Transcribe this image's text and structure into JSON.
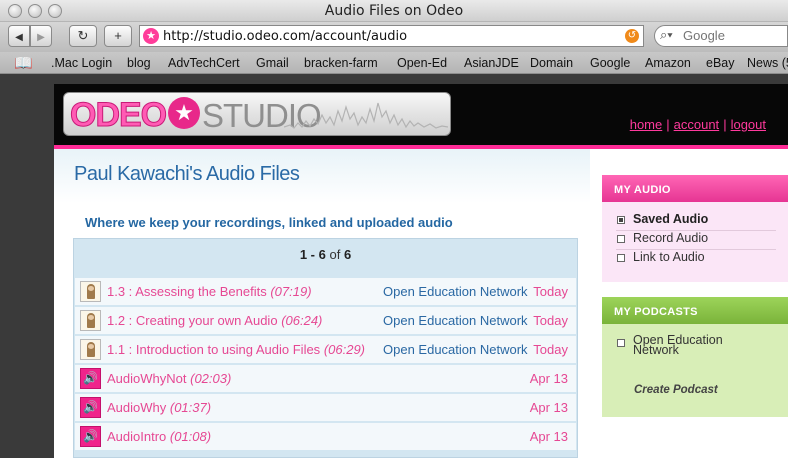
{
  "window": {
    "title": "Audio Files on Odeo"
  },
  "toolbar": {
    "back_label": "◀",
    "forward_label": "▶",
    "reload_label": "↻",
    "add_label": "+",
    "url": "http://studio.odeo.com/account/audio",
    "search_placeholder": "Google"
  },
  "bookmarks": [
    ".Mac Login",
    "blog",
    "AdvTechCert",
    "Gmail",
    "bracken-farm",
    "Open-Ed",
    "AsianJDE",
    "Domain",
    "Google",
    "Amazon",
    "eBay",
    "News (5"
  ],
  "header": {
    "logo_odeo": "ODEO",
    "logo_studio": "STUDIO",
    "nav": [
      "home",
      "account",
      "logout"
    ],
    "nav_sep": "|"
  },
  "main": {
    "title": "Paul Kawachi's Audio Files",
    "subtitle": "Where we keep your recordings, linked and uploaded audio",
    "pager": {
      "range": "1 - 6",
      "of": "of",
      "total": "6"
    },
    "rows": [
      {
        "title": "1.3 : Assessing the Benefits",
        "duration": "(07:19)",
        "network": "Open Education Network",
        "date": "Today",
        "icon": "thumbnail"
      },
      {
        "title": "1.2 : Creating your own Audio",
        "duration": "(06:24)",
        "network": "Open Education Network",
        "date": "Today",
        "icon": "thumbnail"
      },
      {
        "title": "1.1 : Introduction to using Audio Files",
        "duration": "(06:29)",
        "network": "Open Education Network",
        "date": "Today",
        "icon": "thumbnail"
      },
      {
        "title": "AudioWhyNot",
        "duration": "(02:03)",
        "network": "",
        "date": "Apr 13",
        "icon": "speaker"
      },
      {
        "title": "AudioWhy",
        "duration": "(01:37)",
        "network": "",
        "date": "Apr 13",
        "icon": "speaker"
      },
      {
        "title": "AudioIntro",
        "duration": "(01:08)",
        "network": "",
        "date": "Apr 13",
        "icon": "speaker"
      }
    ]
  },
  "sidebar": {
    "my_audio": {
      "heading": "MY AUDIO",
      "items": [
        "Saved Audio",
        "Record Audio",
        "Link to Audio"
      ],
      "active_index": 0
    },
    "my_podcasts": {
      "heading": "MY PODCASTS",
      "items": [
        "Open Education Network"
      ],
      "create_label": "Create Podcast"
    }
  },
  "colors": {
    "brand_pink": "#ff2b96",
    "link_blue": "#2a68a3",
    "podcast_green": "#7ab33a"
  }
}
